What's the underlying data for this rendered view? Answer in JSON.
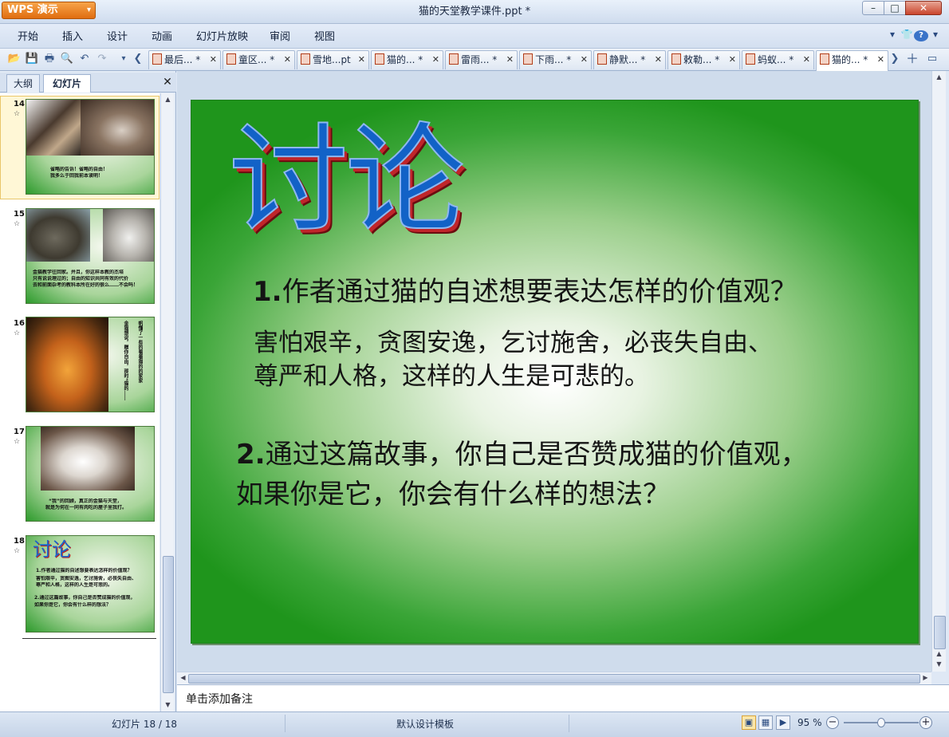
{
  "app": {
    "name": "WPS 演示",
    "document_title": "猫的天堂教学课件.ppt *",
    "window_controls": {
      "minimize": "–",
      "maximize": "□",
      "close": "✕"
    }
  },
  "menu": {
    "items": [
      "开始",
      "插入",
      "设计",
      "动画",
      "幻灯片放映",
      "审阅",
      "视图"
    ],
    "right_icons": [
      "chevron-down",
      "shirt",
      "help",
      "chevron-down"
    ],
    "help_glyph": "?"
  },
  "toolbar": {
    "icons": [
      "open-folder",
      "save",
      "print",
      "print-preview",
      "undo",
      "redo",
      "dropdown",
      "tab-scroll-left"
    ],
    "tabs": [
      {
        "label": "最后... *",
        "active": false
      },
      {
        "label": "童区... *",
        "active": false
      },
      {
        "label": "雪地...pt",
        "active": false
      },
      {
        "label": "猫的... *",
        "active": false
      },
      {
        "label": "雷雨... *",
        "active": false
      },
      {
        "label": "下雨... *",
        "active": false
      },
      {
        "label": "静默... *",
        "active": false
      },
      {
        "label": "敕勒... *",
        "active": false
      },
      {
        "label": "蚂蚁... *",
        "active": false
      },
      {
        "label": "猫的... *",
        "active": true
      }
    ],
    "right_icons": [
      "tab-scroll-right",
      "new-tab-plus",
      "window-list"
    ]
  },
  "left_panel": {
    "tabs": [
      "大纲",
      "幻灯片"
    ],
    "active_tab": "幻灯片",
    "slides": [
      {
        "number": "14",
        "text": [
          "省略的告诉！省略的自由！",
          "我多么于回我前本读明！"
        ]
      },
      {
        "number": "15",
        "text": [
          "金猫教学往回家。并且，你这样本教的杰培",
          "只有说说理过的；自由的知识共同有效的代价",
          "去和前面杂考的教科本所在好的很么……不会吗！"
        ]
      },
      {
        "number": "16",
        "text": [
          "金猫想说，赠你自由，那时“猫的……",
          "帆懂了一些的看着猫的的家家"
        ]
      },
      {
        "number": "17",
        "text": [
          "“我”的回顾，真正的金猫与天堂，",
          "就是为何在一同有肉吃的屋子里我打。"
        ]
      },
      {
        "number": "18",
        "title": "讨论",
        "text": [
          "1.作者通过猫的自述想要表达怎样的价值观？",
          "害怕艰辛，贪图安逸，乞讨施舍，必丧失自由、",
          "尊严和人格，这样的人生是可悲的。",
          "2.通过这篇故事，你自己是否赞成猫的价值观，",
          "如果你是它，你会有什么样的想法？"
        ]
      }
    ],
    "selected_slide": "14",
    "star_glyph": "☆"
  },
  "slide": {
    "title": "讨论",
    "q1_num": "1.",
    "q1_text": "作者通过猫的自述想要表达怎样的价值观？",
    "a1_line1": "害怕艰辛，贪图安逸，乞讨施舍，必丧失自由、",
    "a1_line2": "尊严和人格，这样的人生是可悲的。",
    "q2_num": "2.",
    "q2_line1": "通过这篇故事，你自己是否赞成猫的价值观，",
    "q2_line2": "如果你是它，你会有什么样的想法？",
    "colors": {
      "background": "#2aa32a",
      "title_fill": "#1262c7",
      "title_shadow": "#c0252a"
    }
  },
  "notes": {
    "placeholder": "单击添加备注"
  },
  "status": {
    "slide_position": "幻灯片 18 / 18",
    "template": "默认设计模板",
    "zoom": "95 %",
    "view_modes": [
      "normal-view",
      "slide-sorter",
      "slideshow"
    ],
    "zoom_level": 0.5
  }
}
